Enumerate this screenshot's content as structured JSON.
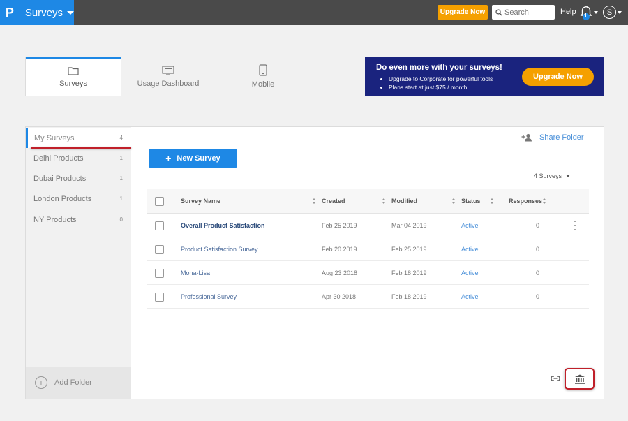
{
  "app": {
    "logo": "P",
    "title": "Surveys"
  },
  "topbar": {
    "upgrade_label": "Upgrade Now",
    "search_placeholder": "Search",
    "help_label": "Help",
    "notification_count": "1",
    "avatar_initial": "S"
  },
  "tabs": [
    {
      "label": "Surveys",
      "icon": "folder-icon",
      "active": true
    },
    {
      "label": "Usage Dashboard",
      "icon": "dashboard-icon",
      "active": false
    },
    {
      "label": "Mobile",
      "icon": "mobile-icon",
      "active": false
    }
  ],
  "promo": {
    "title": "Do even more with your surveys!",
    "bullets": [
      "Upgrade to Corporate for powerful tools",
      "Plans start at just $75 / month"
    ],
    "button_label": "Upgrade Now"
  },
  "sidebar": {
    "folders": [
      {
        "label": "My Surveys",
        "count": "4",
        "active": true
      },
      {
        "label": "Delhi Products",
        "count": "1"
      },
      {
        "label": "Dubai Products",
        "count": "1"
      },
      {
        "label": "London Products",
        "count": "1"
      },
      {
        "label": "NY Products",
        "count": "0"
      }
    ],
    "add_folder_label": "Add Folder"
  },
  "main": {
    "share_label": "Share Folder",
    "new_survey_label": "New Survey",
    "survey_count_label": "4 Surveys"
  },
  "table": {
    "headers": {
      "name": "Survey Name",
      "created": "Created",
      "modified": "Modified",
      "status": "Status",
      "responses": "Responses"
    },
    "rows": [
      {
        "name": "Overall Product Satisfaction",
        "created": "Feb 25 2019",
        "modified": "Mar 04 2019",
        "status": "Active",
        "responses": "0",
        "bold": true
      },
      {
        "name": "Product Satisfaction Survey",
        "created": "Feb 20 2019",
        "modified": "Feb 25 2019",
        "status": "Active",
        "responses": "0"
      },
      {
        "name": "Mona-Lisa",
        "created": "Aug 23 2018",
        "modified": "Feb 18 2019",
        "status": "Active",
        "responses": "0"
      },
      {
        "name": "Professional Survey",
        "created": "Apr 30 2018",
        "modified": "Feb 18 2019",
        "status": "Active",
        "responses": "0"
      }
    ]
  },
  "colors": {
    "brand_blue": "#1e88e5",
    "topbar": "#4a4a4a",
    "orange": "#f5a000",
    "promo_navy": "#1a237e",
    "highlight_red": "#c0202a"
  }
}
